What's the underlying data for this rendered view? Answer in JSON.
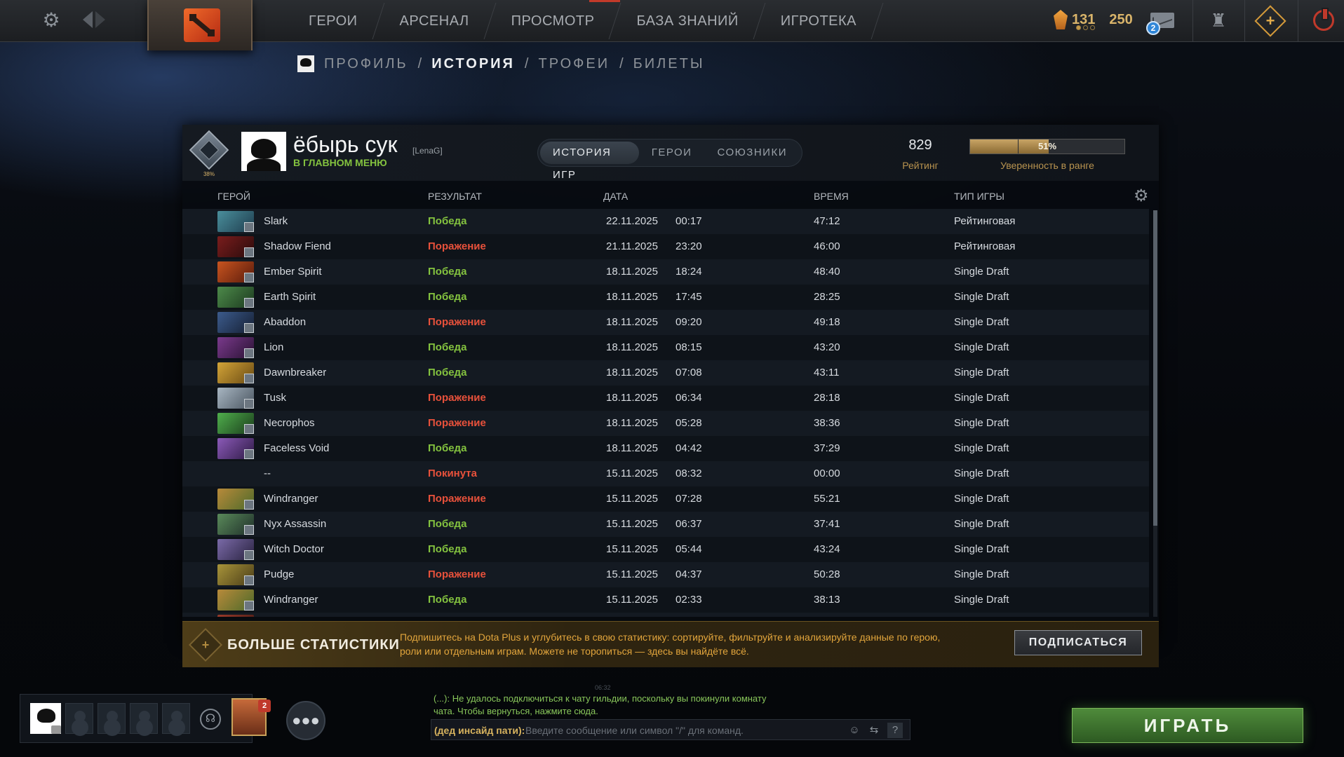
{
  "topbar": {
    "nav": [
      "ГЕРОИ",
      "АРСЕНАЛ",
      "ПРОСМОТР",
      "БАЗА ЗНАНИЙ",
      "ИГРОТЕКА"
    ],
    "shards": "131",
    "coins": "250",
    "mail_count": "2"
  },
  "subnav": {
    "profile": "ПРОФИЛЬ",
    "history": "ИСТОРИЯ",
    "trophies": "ТРОФЕИ",
    "tickets": "БИЛЕТЫ",
    "separator": "/"
  },
  "profile": {
    "rank_percent": "38%",
    "name": "ёбырь сук",
    "tag": "[LenaG]",
    "status": "В ГЛАВНОМ МЕНЮ",
    "tabs": [
      "ИСТОРИЯ ИГР",
      "ГЕРОИ",
      "СОЮЗНИКИ"
    ],
    "rating_value": "829",
    "rating_label": "Рейтинг",
    "confidence_percent": 51,
    "confidence_text": "51%",
    "confidence_label": "Уверенность в ранге"
  },
  "table": {
    "headers": {
      "hero": "ГЕРОЙ",
      "result": "РЕЗУЛЬТАТ",
      "date": "ДАТА",
      "duration": "ВРЕМЯ",
      "mode": "ТИП ИГРЫ"
    },
    "rows": [
      {
        "hero": "Slark",
        "result": "Победа",
        "outcome": "win",
        "date": "22.11.2025",
        "time": "00:17",
        "duration": "47:12",
        "mode": "Рейтинговая",
        "colors": [
          "#4a8f9c",
          "#1f3d4e"
        ]
      },
      {
        "hero": "Shadow Fiend",
        "result": "Поражение",
        "outcome": "loss",
        "date": "21.11.2025",
        "time": "23:20",
        "duration": "46:00",
        "mode": "Рейтинговая",
        "colors": [
          "#7a1d1d",
          "#2a0b0b"
        ]
      },
      {
        "hero": "Ember Spirit",
        "result": "Победа",
        "outcome": "win",
        "date": "18.11.2025",
        "time": "18:24",
        "duration": "48:40",
        "mode": "Single Draft",
        "colors": [
          "#c8541f",
          "#5a1b0c"
        ]
      },
      {
        "hero": "Earth Spirit",
        "result": "Победа",
        "outcome": "win",
        "date": "18.11.2025",
        "time": "17:45",
        "duration": "28:25",
        "mode": "Single Draft",
        "colors": [
          "#4d8a4a",
          "#1c3a1f"
        ]
      },
      {
        "hero": "Abaddon",
        "result": "Поражение",
        "outcome": "loss",
        "date": "18.11.2025",
        "time": "09:20",
        "duration": "49:18",
        "mode": "Single Draft",
        "colors": [
          "#3c5b8c",
          "#151f33"
        ]
      },
      {
        "hero": "Lion",
        "result": "Победа",
        "outcome": "win",
        "date": "18.11.2025",
        "time": "08:15",
        "duration": "43:20",
        "mode": "Single Draft",
        "colors": [
          "#7a3a8c",
          "#2a1233"
        ]
      },
      {
        "hero": "Dawnbreaker",
        "result": "Победа",
        "outcome": "win",
        "date": "18.11.2025",
        "time": "07:08",
        "duration": "43:11",
        "mode": "Single Draft",
        "colors": [
          "#d3a438",
          "#6a4b14"
        ]
      },
      {
        "hero": "Tusk",
        "result": "Поражение",
        "outcome": "loss",
        "date": "18.11.2025",
        "time": "06:34",
        "duration": "28:18",
        "mode": "Single Draft",
        "colors": [
          "#a8b6c2",
          "#4a5560"
        ]
      },
      {
        "hero": "Necrophos",
        "result": "Поражение",
        "outcome": "loss",
        "date": "18.11.2025",
        "time": "05:28",
        "duration": "38:36",
        "mode": "Single Draft",
        "colors": [
          "#4fae4c",
          "#1b3d1c"
        ]
      },
      {
        "hero": "Faceless Void",
        "result": "Победа",
        "outcome": "win",
        "date": "18.11.2025",
        "time": "04:42",
        "duration": "37:29",
        "mode": "Single Draft",
        "colors": [
          "#8b5ab8",
          "#2e1a45"
        ]
      },
      {
        "hero": "--",
        "result": "Покинута",
        "outcome": "abandon",
        "date": "15.11.2025",
        "time": "08:32",
        "duration": "00:00",
        "mode": "Single Draft",
        "colors": []
      },
      {
        "hero": "Windranger",
        "result": "Поражение",
        "outcome": "loss",
        "date": "15.11.2025",
        "time": "07:28",
        "duration": "55:21",
        "mode": "Single Draft",
        "colors": [
          "#b88a3a",
          "#4d6a2a"
        ]
      },
      {
        "hero": "Nyx Assassin",
        "result": "Победа",
        "outcome": "win",
        "date": "15.11.2025",
        "time": "06:37",
        "duration": "37:41",
        "mode": "Single Draft",
        "colors": [
          "#5a8a5a",
          "#1f2f2a"
        ]
      },
      {
        "hero": "Witch Doctor",
        "result": "Победа",
        "outcome": "win",
        "date": "15.11.2025",
        "time": "05:44",
        "duration": "43:24",
        "mode": "Single Draft",
        "colors": [
          "#7a6aa8",
          "#2a2340"
        ]
      },
      {
        "hero": "Pudge",
        "result": "Поражение",
        "outcome": "loss",
        "date": "15.11.2025",
        "time": "04:37",
        "duration": "50:28",
        "mode": "Single Draft",
        "colors": [
          "#a8943a",
          "#4a3d18"
        ]
      },
      {
        "hero": "Windranger",
        "result": "Победа",
        "outcome": "win",
        "date": "15.11.2025",
        "time": "02:33",
        "duration": "38:13",
        "mode": "Single Draft",
        "colors": [
          "#b88a3a",
          "#4d6a2a"
        ]
      },
      {
        "hero": "",
        "result": "",
        "outcome": "",
        "date": "",
        "time": "",
        "duration": "",
        "mode": "",
        "colors": [
          "#9a3a2a",
          "#3a1510"
        ]
      }
    ]
  },
  "promo": {
    "title": "БОЛЬШЕ СТАТИСТИКИ",
    "text": "Подпишитесь на Dota Plus и углубитесь в свою статистику: сортируйте, фильтруйте и анализируйте данные по герою, роли или отдельным играм. Можете не торопиться — здесь вы найдёте всё.",
    "button": "ПОДПИСАТЬСЯ"
  },
  "party": {
    "friend_badge": "2"
  },
  "chat": {
    "timestamp": "06:32",
    "message": "(...): Не удалось подключиться к чату гильдии, поскольку вы покинули комнату чата. Чтобы вернуться, нажмите сюда.",
    "channel": "(дед инсайд пати):",
    "placeholder": "Введите сообщение или символ \"/\" для команд.",
    "help": "?"
  },
  "play_button": "ИГРАТЬ"
}
